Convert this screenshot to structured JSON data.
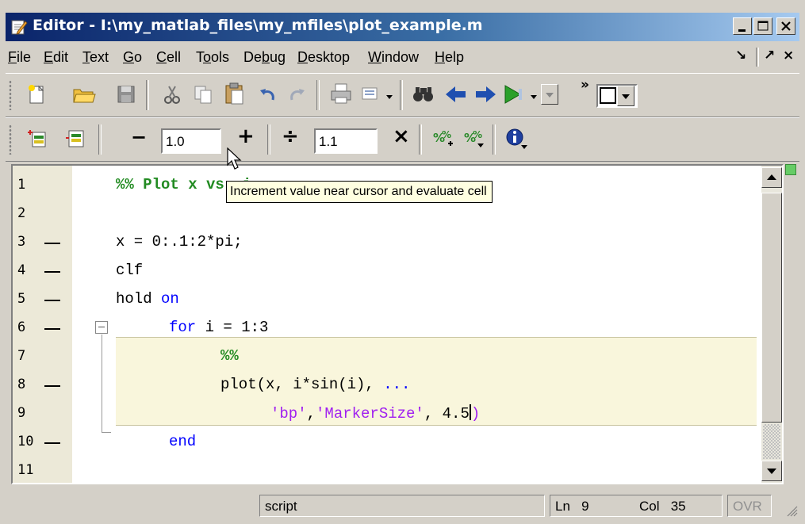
{
  "window": {
    "title": "Editor - I:\\my_matlab_files\\my_mfiles\\plot_example.m",
    "minimize_label": "_",
    "restore_label": "□",
    "close_label": "×"
  },
  "menu": {
    "items": [
      {
        "label": "File",
        "mnemonic": "F"
      },
      {
        "label": "Edit",
        "mnemonic": "E"
      },
      {
        "label": "Text",
        "mnemonic": "T"
      },
      {
        "label": "Go",
        "mnemonic": "G"
      },
      {
        "label": "Cell",
        "mnemonic": "C"
      },
      {
        "label": "Tools",
        "mnemonic": "o"
      },
      {
        "label": "Debug",
        "mnemonic": "b"
      },
      {
        "label": "Desktop",
        "mnemonic": "D"
      },
      {
        "label": "Window",
        "mnemonic": "W"
      },
      {
        "label": "Help",
        "mnemonic": "H"
      }
    ],
    "dock_glyph": "↘",
    "undock_glyph": "↗",
    "close_glyph": "×"
  },
  "toolbar": {
    "overflow_glyph": "»",
    "icons": [
      "new-file-icon",
      "open-folder-icon",
      "save-icon",
      "cut-icon",
      "copy-icon",
      "paste-icon",
      "undo-icon",
      "redo-icon",
      "print-icon",
      "find-files-icon",
      "find-icon",
      "back-icon",
      "forward-icon",
      "run-icon"
    ]
  },
  "cell_toolbar": {
    "decrement_label": "−",
    "increment_label": "+",
    "increment_value": "1.0",
    "divide_label": "÷",
    "multiply_label": "×",
    "multiply_value": "1.1",
    "tooltip": "Increment value near cursor and evaluate cell"
  },
  "editor": {
    "lines": [
      {
        "num": "1",
        "breakpoint": false
      },
      {
        "num": "2",
        "breakpoint": false
      },
      {
        "num": "3",
        "breakpoint": true
      },
      {
        "num": "4",
        "breakpoint": true
      },
      {
        "num": "5",
        "breakpoint": true
      },
      {
        "num": "6",
        "breakpoint": true
      },
      {
        "num": "7",
        "breakpoint": false
      },
      {
        "num": "8",
        "breakpoint": true
      },
      {
        "num": "9",
        "breakpoint": false
      },
      {
        "num": "10",
        "breakpoint": true
      },
      {
        "num": "11",
        "breakpoint": false
      }
    ],
    "code": {
      "l1_comment": "%% Plot x",
      "l1_rest": " vs. i",
      "l3": "x = 0:.1:2*pi;",
      "l4": "clf",
      "l5_a": "hold ",
      "l5_kw": "on",
      "l6_kw": "for",
      "l6_rest": " i = 1:3",
      "l7_comment": "%%",
      "l8_a": "plot(x, i*sin(i), ",
      "l8_cont": "...",
      "l9_s1": "'bp'",
      "l9_comma": ",",
      "l9_s2": "'MarkerSize'",
      "l9_rest": ", 4.5",
      "l9_paren": ")",
      "l10_kw": "end"
    },
    "fold_glyph": "−",
    "status_indicator_color": "#66cc66"
  },
  "statusbar": {
    "mode": "script",
    "line_label": "Ln",
    "line_value": "9",
    "col_label": "Col",
    "col_value": "35",
    "ovr": "OVR"
  }
}
